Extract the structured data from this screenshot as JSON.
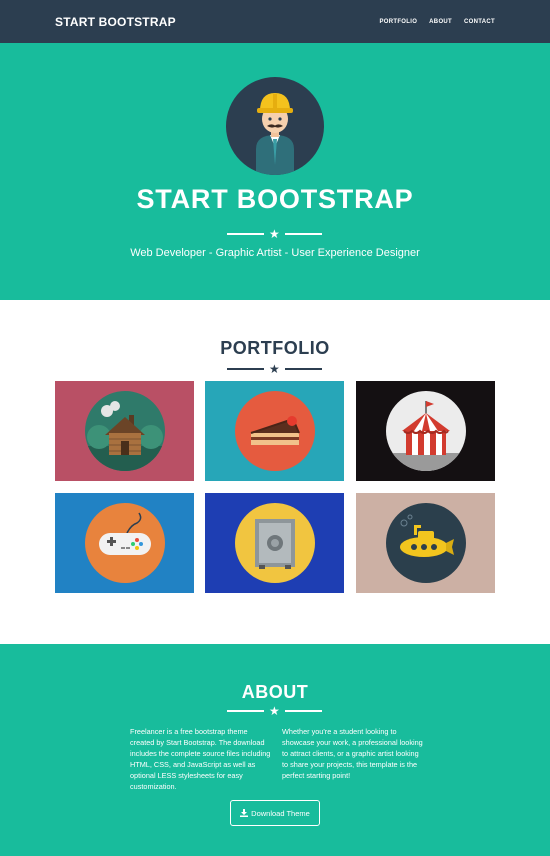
{
  "nav": {
    "brand": "START BOOTSTRAP",
    "items": [
      {
        "label": "PORTFOLIO"
      },
      {
        "label": "ABOUT"
      },
      {
        "label": "CONTACT"
      }
    ]
  },
  "header": {
    "title": "START BOOTSTRAP",
    "subtitle": "Web Developer - Graphic Artist - User Experience Designer"
  },
  "portfolio": {
    "title": "PORTFOLIO",
    "items": [
      {
        "icon": "cabin-icon",
        "bg": "#b95065"
      },
      {
        "icon": "cake-icon",
        "bg": "#27a6b8"
      },
      {
        "icon": "circus-tent-icon",
        "bg": "#141012"
      },
      {
        "icon": "game-controller-icon",
        "bg": "#2182c4"
      },
      {
        "icon": "safe-icon",
        "bg": "#1e3eb3"
      },
      {
        "icon": "submarine-icon",
        "bg": "#ccb0a4"
      }
    ]
  },
  "about": {
    "title": "ABOUT",
    "left_text": "Freelancer is a free bootstrap theme created by Start Bootstrap. The download includes the complete source files including HTML, CSS, and JavaScript as well as optional LESS stylesheets for easy customization.",
    "right_text": "Whether you're a student looking to showcase your work, a professional looking to attract clients, or a graphic artist looking to share your projects, this template is the perfect starting point!",
    "button_label": "Download Theme"
  },
  "colors": {
    "primary": "#2c3e50",
    "accent": "#18bc9c"
  }
}
